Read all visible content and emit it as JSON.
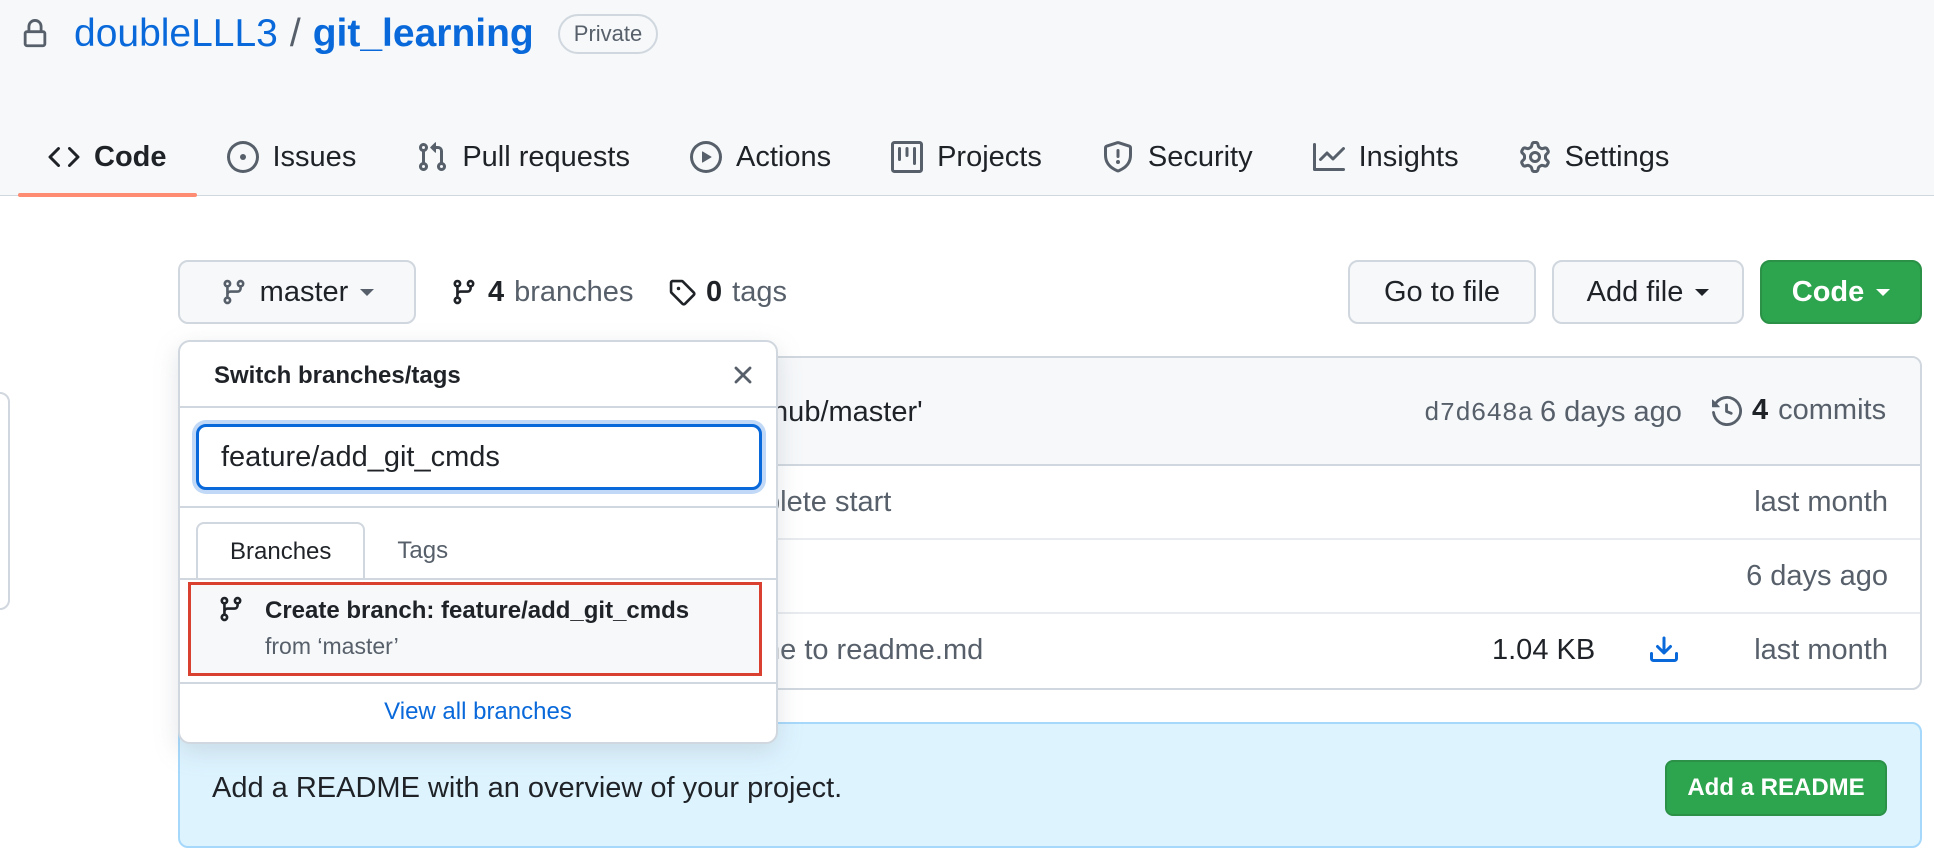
{
  "repo": {
    "owner": "doubleLLL3",
    "separator": "/",
    "name": "git_learning",
    "visibility": "Private"
  },
  "nav_tabs": [
    {
      "label": "Code",
      "icon": "code-icon",
      "selected": true
    },
    {
      "label": "Issues",
      "icon": "issue-icon"
    },
    {
      "label": "Pull requests",
      "icon": "pull-request-icon"
    },
    {
      "label": "Actions",
      "icon": "play-icon"
    },
    {
      "label": "Projects",
      "icon": "project-icon"
    },
    {
      "label": "Security",
      "icon": "shield-icon"
    },
    {
      "label": "Insights",
      "icon": "graph-icon"
    },
    {
      "label": "Settings",
      "icon": "gear-icon"
    }
  ],
  "toolbar": {
    "branch": "master",
    "branches_count": "4",
    "branches_label": "branches",
    "tags_count": "0",
    "tags_label": "tags",
    "go_to_file": "Go to file",
    "add_file": "Add file",
    "code": "Code"
  },
  "commit": {
    "message_partial": "thub/master'",
    "sha": "d7d648a",
    "time": "6 days ago",
    "commits_count": "4",
    "commits_label": "commits"
  },
  "files": [
    {
      "message_partial": "plete start",
      "size": "",
      "time": "last month"
    },
    {
      "message_partial": "",
      "size": "",
      "time": "6 days ago"
    },
    {
      "message_partial": "ne to readme.md",
      "size": "1.04 KB",
      "time": "last month"
    }
  ],
  "readme_banner": {
    "text": "Add a README with an overview of your project.",
    "button": "Add a README"
  },
  "dropdown": {
    "title": "Switch branches/tags",
    "filter_value": "feature/add_git_cmds",
    "tabs": [
      "Branches",
      "Tags"
    ],
    "create_title": "Create branch: feature/add_git_cmds",
    "create_sub": "from ‘master’",
    "footer": "View all branches"
  },
  "colors": {
    "accent": "#0969da",
    "tab_underline": "#fd8c73",
    "green_button": "#2da44e",
    "highlight_box": "#d9402f"
  }
}
